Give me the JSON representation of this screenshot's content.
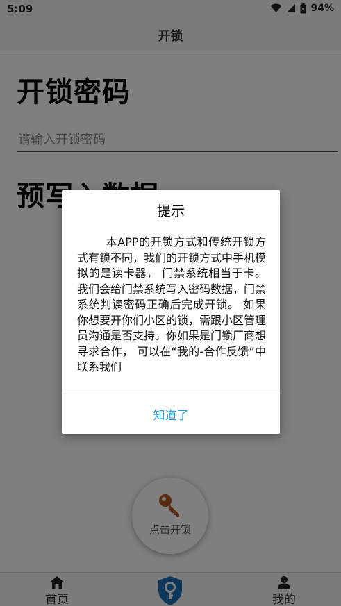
{
  "status_bar": {
    "time": "5:09",
    "battery": "94%",
    "wifi_icon": "wifi-icon",
    "signal_icon": "signal-icon",
    "battery_icon": "battery-icon"
  },
  "header": {
    "title": "开锁"
  },
  "main": {
    "password_heading": "开锁密码",
    "password_placeholder": "请输入开锁密码",
    "prewrite_heading": "预写入数据"
  },
  "fab": {
    "label": "点击开锁",
    "icon": "key-icon",
    "icon_color": "#b5551c"
  },
  "bottom_nav": {
    "items": [
      {
        "label": "首页",
        "icon": "home-icon"
      },
      {
        "label": "",
        "icon": "shield-key-icon",
        "color": "#1a6fb5"
      },
      {
        "label": "我的",
        "icon": "person-icon"
      }
    ]
  },
  "dialog": {
    "title": "提示",
    "message": "本APP的开锁方式和传统开锁方式有锁不同，我们的开锁方式中手机模拟的是读卡器， 门禁系统相当于卡。我们会给门禁系统写入密码数据，门禁系统判读密码正确后完成开锁。 如果你想要开你们小区的锁，需跟小区管理员沟通是否支持。你如果是门锁厂商想寻求合作， 可以在“我的-合作反馈”中联系我们",
    "confirm_label": "知道了",
    "accent_color": "#1fa3d6"
  }
}
